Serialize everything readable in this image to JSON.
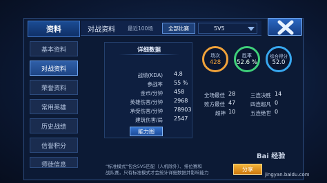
{
  "sidebar": {
    "title": "资料",
    "items": [
      {
        "label": "基本资料",
        "active": false
      },
      {
        "label": "对战资料",
        "active": true
      },
      {
        "label": "荣誉资料",
        "active": false
      },
      {
        "label": "常用英雄",
        "active": false
      },
      {
        "label": "历史战绩",
        "active": false
      },
      {
        "label": "信誉积分",
        "active": false
      },
      {
        "label": "师徒信息",
        "active": false
      }
    ]
  },
  "topbar": {
    "title": "对战资料",
    "recent": "最近100场",
    "filter_all": "全部比赛",
    "mode_select": "5V5"
  },
  "detail": {
    "title": "详细数据",
    "rows": [
      {
        "label": "战绩(KDA)",
        "value": "4.8"
      },
      {
        "label": "参战率",
        "value": "55 %"
      },
      {
        "label": "金币/分钟",
        "value": "458"
      },
      {
        "label": "英雄伤害/分钟",
        "value": "2968"
      },
      {
        "label": "承受伤害/分钟",
        "value": "78903"
      },
      {
        "label": "建筑伤害/局",
        "value": "2547"
      }
    ],
    "ability_button": "能力图"
  },
  "circles": [
    {
      "label": "场次",
      "value": "428",
      "color": "#f0a23a"
    },
    {
      "label": "胜率",
      "value": "52.6 %",
      "color": "#3fd07a"
    },
    {
      "label": "综合得分",
      "value": "52.0",
      "color": "#38a8f0"
    }
  ],
  "stats": [
    {
      "label": "全场最佳",
      "value": "28"
    },
    {
      "label": "三连决胜",
      "value": "14"
    },
    {
      "label": "败方最佳",
      "value": "47"
    },
    {
      "label": "四连超凡",
      "value": "0"
    },
    {
      "label": "超神",
      "value": "10"
    },
    {
      "label": "五连绝世",
      "value": "0"
    }
  ],
  "notice": {
    "line1": "“标准模式”包含5V5匹配（人机除外）、排位赛和",
    "line2": "战队赛，只有标准模式才会统计详细数据并影响能力"
  },
  "share_button": "分享",
  "watermark": {
    "text": "Bai 经验",
    "url": "jingyan.baidu.com"
  },
  "colors": {
    "accent": "#2b68c2",
    "share": "#f2b338"
  }
}
